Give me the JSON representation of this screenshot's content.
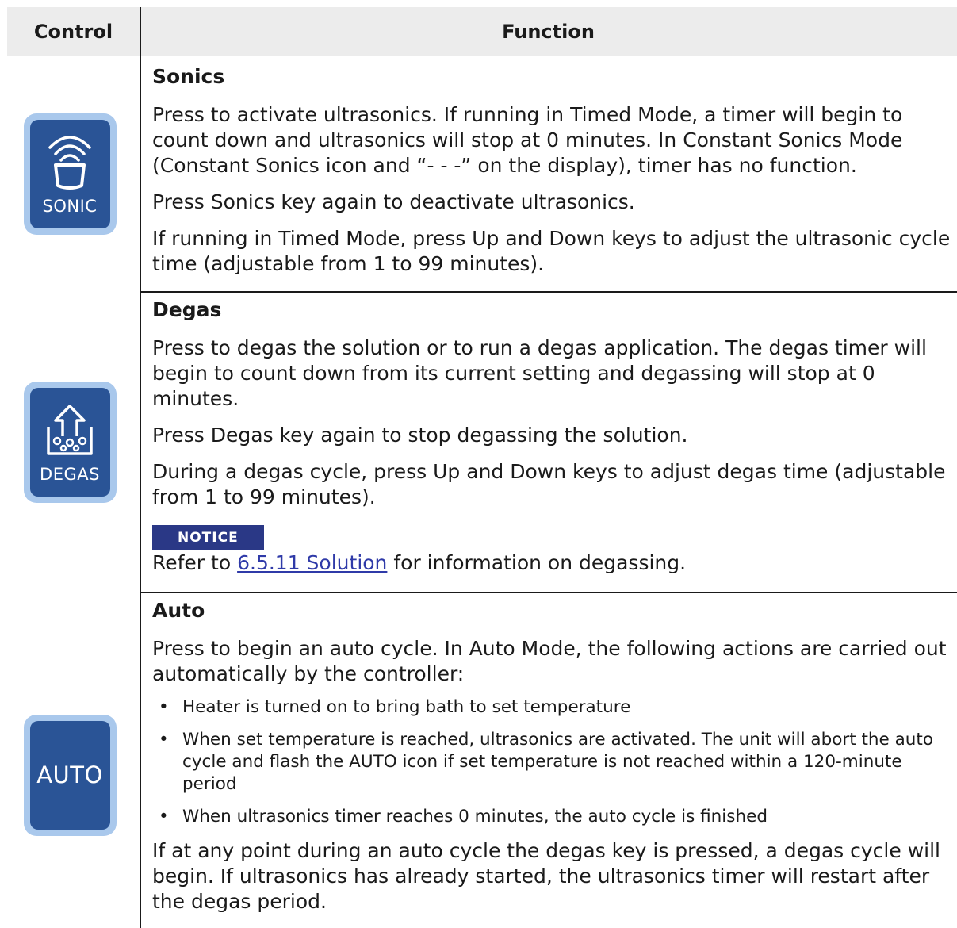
{
  "header": {
    "control": "Control",
    "function": "Function"
  },
  "rows": [
    {
      "icon": "sonic-key-icon",
      "key_label": "SONIC",
      "title": "Sonics",
      "paragraphs": [
        "Press to activate ultrasonics. If running in Timed Mode, a timer will begin to count down and ultrasonics will stop at 0 minutes. In Constant Sonics Mode (Constant Sonics icon and “- - -” on the display), timer has no function.",
        "Press Sonics key again to deactivate ultrasonics.",
        "If running in Timed Mode, press Up and Down keys to adjust the ultrasonic cycle time (adjustable from 1 to 99 minutes)."
      ]
    },
    {
      "icon": "degas-key-icon",
      "key_label": "DEGAS",
      "title": "Degas",
      "paragraphs": [
        "Press to degas the solution or to run a degas application. The degas timer will begin to count down from its current setting and degassing will stop at 0 minutes.",
        "Press Degas key again to stop degassing the solution.",
        "During a degas cycle, press Up and Down keys to adjust degas time (adjustable from 1 to 99 minutes)."
      ],
      "notice": {
        "badge": "NOTICE",
        "prefix": "Refer to ",
        "link": "6.5.11 Solution",
        "suffix": " for information on degassing."
      }
    },
    {
      "icon": "auto-key-icon",
      "key_label": "AUTO",
      "title": "Auto",
      "intro": "Press to begin an auto cycle. In Auto Mode, the following actions are carried out automatically by the controller:",
      "bullets": [
        "Heater is turned on to bring bath to set temperature",
        "When set temperature is reached, ultrasonics are activated. The unit will abort the auto cycle and flash the AUTO icon if set temperature is not reached within a 120-minute period",
        "When ultrasonics timer reaches 0 minutes, the auto cycle is finished"
      ],
      "outro": "If at any point during an auto cycle the degas key is pressed, a degas cycle will begin. If ultrasonics has already started, the ultrasonics timer will restart after the degas period."
    }
  ],
  "colors": {
    "key_outer": "#a9c8ec",
    "key_inner": "#2a5496",
    "notice_bg": "#2a3886",
    "link": "#2f3aa8",
    "header_bg": "#ececec"
  }
}
